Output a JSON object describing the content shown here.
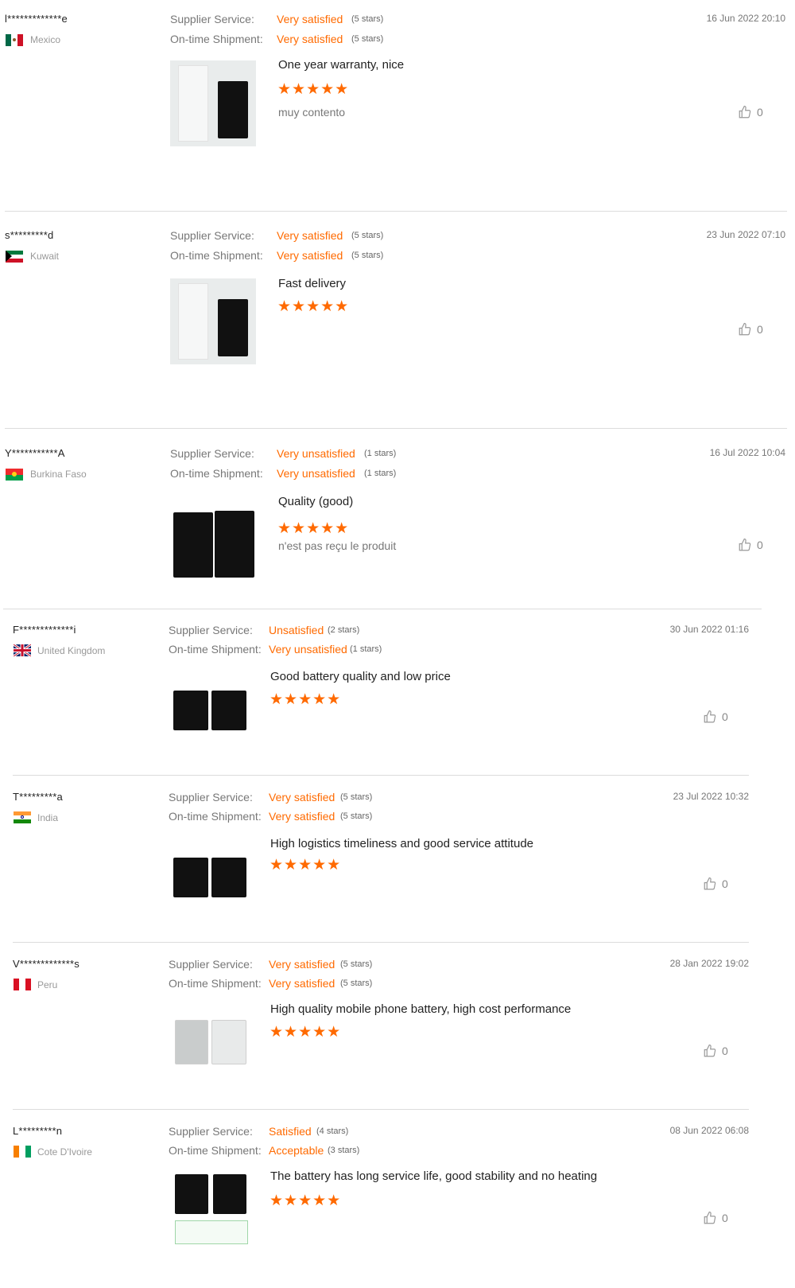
{
  "labels": {
    "supplier_service": "Supplier Service:",
    "ontime_shipment": "On-time Shipment:"
  },
  "icons": {
    "like": "thumbs-up-icon",
    "star": "star-icon"
  },
  "colors": {
    "accent": "#ff6a00",
    "divider": "#dcdcdc"
  },
  "reviews": [
    {
      "user": "l*************e",
      "country": "Mexico",
      "flag": "mexico",
      "supplier_value": "Very satisfied",
      "supplier_stars": "(5 stars)",
      "shipment_value": "Very satisfied",
      "shipment_stars": "(5 stars)",
      "date": "16 Jun 2022 20:10",
      "title": "One year warranty, nice",
      "rating": 5,
      "stars": "★★★★★",
      "comment": "muy contento",
      "likes": "0"
    },
    {
      "user": "s*********d",
      "country": "Kuwait",
      "flag": "kuwait",
      "supplier_value": "Very satisfied",
      "supplier_stars": "(5 stars)",
      "shipment_value": "Very satisfied",
      "shipment_stars": "(5 stars)",
      "date": "23 Jun 2022 07:10",
      "title": "Fast delivery",
      "rating": 5,
      "stars": "★★★★★",
      "comment": "",
      "likes": "0"
    },
    {
      "user": "Y***********A",
      "country": "Burkina Faso",
      "flag": "burkina",
      "supplier_value": "Very unsatisfied",
      "supplier_stars": "(1 stars)",
      "shipment_value": "Very unsatisfied",
      "shipment_stars": "(1 stars)",
      "date": "16 Jul 2022 10:04",
      "title": "Quality (good)",
      "rating": 5,
      "stars": "★★★★★",
      "comment": "n'est pas reçu le produit",
      "likes": "0"
    },
    {
      "user": "F*************i",
      "country": "United Kingdom",
      "flag": "uk",
      "supplier_value": "Unsatisfied",
      "supplier_stars": "(2 stars)",
      "shipment_value": "Very unsatisfied",
      "shipment_stars": "(1 stars)",
      "date": "30 Jun 2022 01:16",
      "title": "Good battery quality and low price",
      "rating": 5,
      "stars": "★★★★★",
      "comment": "",
      "likes": "0"
    },
    {
      "user": "T*********a",
      "country": "India",
      "flag": "india",
      "supplier_value": "Very satisfied",
      "supplier_stars": "(5 stars)",
      "shipment_value": "Very satisfied",
      "shipment_stars": "(5 stars)",
      "date": "23 Jul 2022 10:32",
      "title": "High logistics timeliness and good service attitude",
      "rating": 5,
      "stars": "★★★★★",
      "comment": "",
      "likes": "0"
    },
    {
      "user": "V*************s",
      "country": "Peru",
      "flag": "peru",
      "supplier_value": "Very satisfied",
      "supplier_stars": "(5 stars)",
      "shipment_value": "Very satisfied",
      "shipment_stars": "(5 stars)",
      "date": "28 Jan 2022 19:02",
      "title": "High quality mobile phone battery, high cost performance",
      "rating": 5,
      "stars": "★★★★★",
      "comment": "",
      "likes": "0"
    },
    {
      "user": "L*********n",
      "country": "Cote D'Ivoire",
      "flag": "ivory",
      "supplier_value": "Satisfied",
      "supplier_stars": "(4 stars)",
      "shipment_value": "Acceptable",
      "shipment_stars": "(3 stars)",
      "date": "08 Jun 2022 06:08",
      "title": "The battery has long service life, good stability and no heating",
      "rating": 5,
      "stars": "★★★★★",
      "comment": "",
      "likes": "0"
    }
  ]
}
